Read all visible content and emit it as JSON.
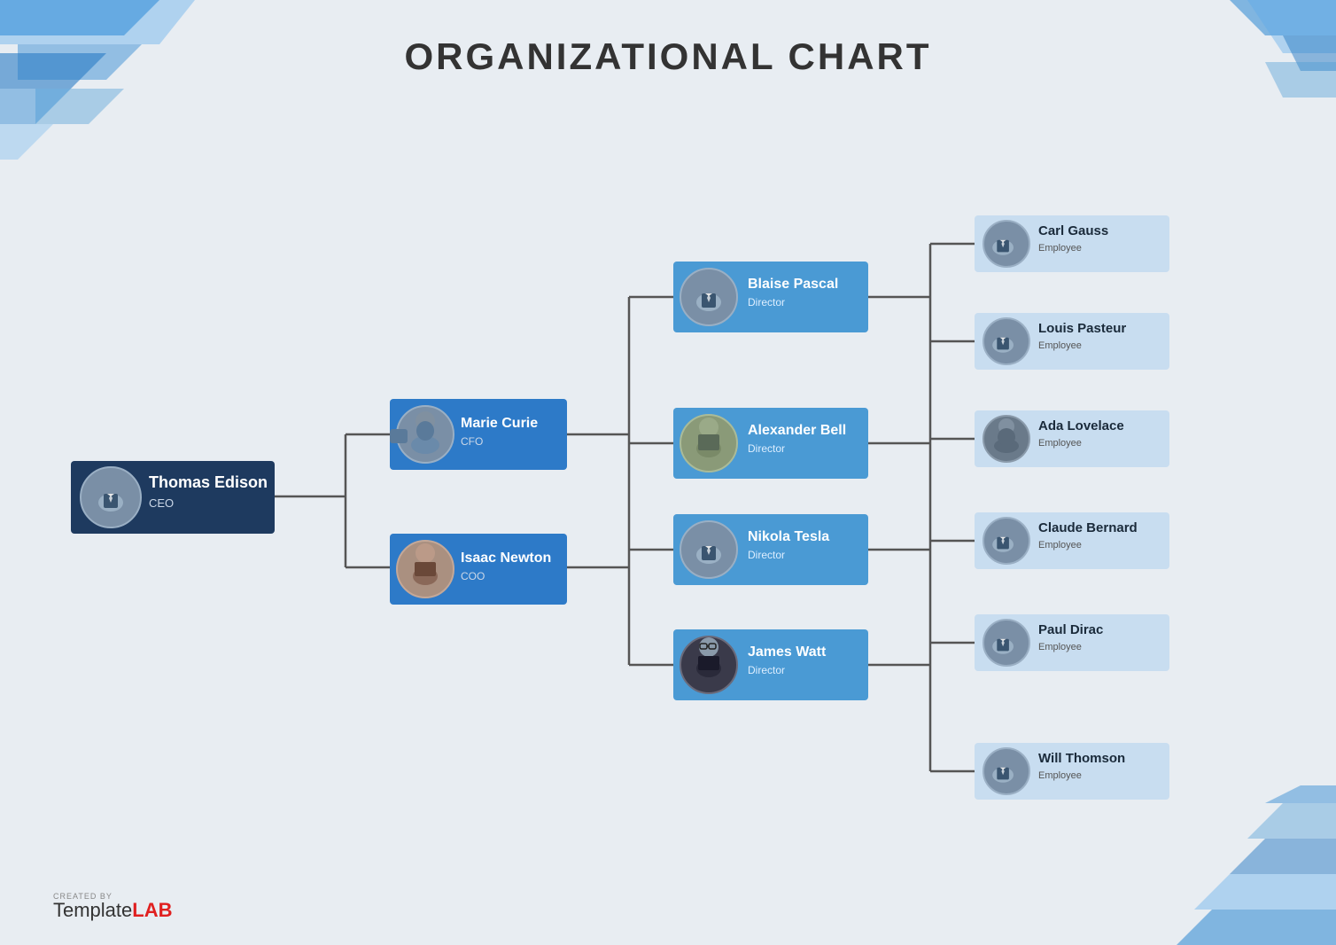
{
  "title": "ORGANIZATIONAL CHART",
  "nodes": {
    "ceo": {
      "name": "Thomas Edison",
      "title": "CEO"
    },
    "cfo": {
      "name": "Marie Curie",
      "title": "CFO"
    },
    "coo": {
      "name": "Isaac Newton",
      "title": "COO"
    },
    "directors": [
      {
        "name": "Blaise Pascal",
        "title": "Director"
      },
      {
        "name": "Alexander Bell",
        "title": "Director"
      },
      {
        "name": "Nikola Tesla",
        "title": "Director"
      },
      {
        "name": "James Watt",
        "title": "Director"
      }
    ],
    "employees": [
      {
        "name": "Carl Gauss",
        "title": "Employee"
      },
      {
        "name": "Louis Pasteur",
        "title": "Employee"
      },
      {
        "name": "Ada Lovelace",
        "title": "Employee"
      },
      {
        "name": "Claude Bernard",
        "title": "Employee"
      },
      {
        "name": "Paul Dirac",
        "title": "Employee"
      },
      {
        "name": "Will Thomson",
        "title": "Employee"
      }
    ]
  },
  "watermark": {
    "created_by": "CREATED BY",
    "brand_plain": "Template",
    "brand_bold": "LAB"
  },
  "colors": {
    "ceo_bg": "#1e3a5f",
    "manager_bg": "#2d7ac8",
    "director_bg": "#4a9ad4",
    "employee_bg": "#d6e8f5",
    "line_color": "#555"
  }
}
